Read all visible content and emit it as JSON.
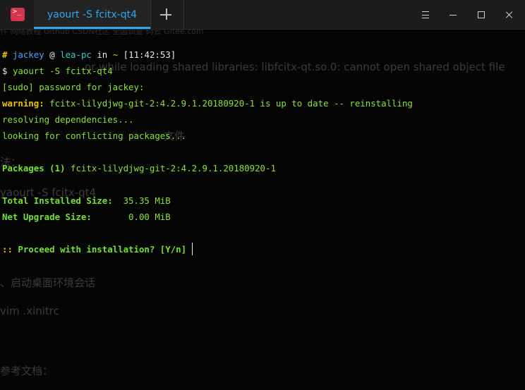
{
  "window": {
    "tab_title": "yaourt -S fcitx-qt4",
    "icon": "terminal-icon",
    "controls": [
      "menu-icon",
      "minimize-icon",
      "maximize-icon",
      "close-icon"
    ]
  },
  "background_page": {
    "bookmarks": "件   网络教程   Github   CSDN社区   全国调查   码云 Gitee.com",
    "snippets": [
      "or while loading shared libraries: libfcitx-qt.so.0: cannot open shared object file",
      "文件",
      "法：",
      "yaourt -S fcitx-qt4",
      "、启动桌面环境会话",
      "vim .xinitrc",
      "参考文档："
    ]
  },
  "terminal": {
    "prompt": {
      "hash": "#",
      "user": "jackey",
      "at": "@",
      "host": "lea-pc",
      "in": "in",
      "dir": "~",
      "time": "[11:42:53]"
    },
    "command": {
      "symbol": "$",
      "text": "yaourt -S fcitx-qt4"
    },
    "sudo_prompt": "[sudo] password for jackey:",
    "warning": {
      "label": "warning:",
      "text": "fcitx-lilydjwg-git-2:4.2.9.1.20180920-1 is up to date -- reinstalling"
    },
    "resolving": "resolving dependencies...",
    "conflicts": "looking for conflicting packages...",
    "packages": {
      "label": "Packages (1)",
      "value": "fcitx-lilydjwg-git-2:4.2.9.1.20180920-1"
    },
    "total_installed": {
      "label": "Total Installed Size:",
      "value": "35.35 MiB"
    },
    "net_upgrade": {
      "label": "Net Upgrade Size:",
      "value": "0.00 MiB"
    },
    "proceed": {
      "marker": "::",
      "text": "Proceed with installation? [Y/n]"
    }
  },
  "colors": {
    "accent_tab": "#2ea8f2",
    "icon_red": "#d7344b",
    "green": "#8ae234",
    "yellow": "#e6c300"
  }
}
